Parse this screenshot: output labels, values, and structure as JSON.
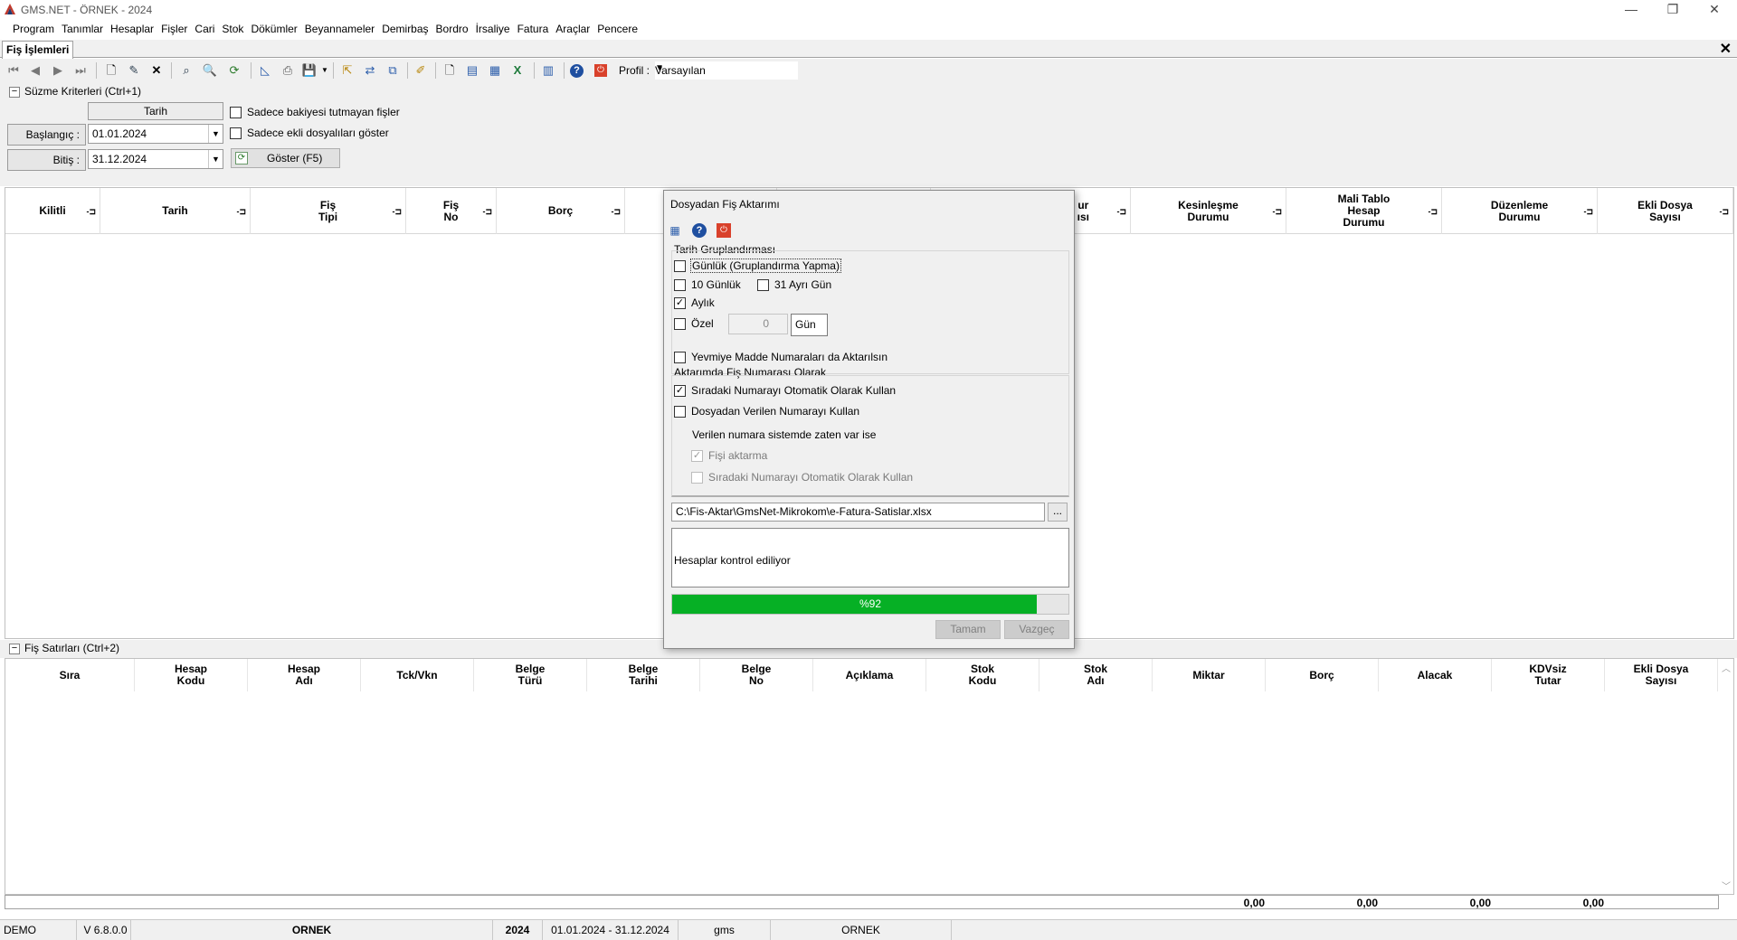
{
  "window": {
    "title": "GMS.NET - ÖRNEK - 2024",
    "minimize": "—",
    "restore": "❐",
    "close": "✕"
  },
  "menu": [
    "Program",
    "Tanımlar",
    "Hesaplar",
    "Fişler",
    "Cari",
    "Stok",
    "Dökümler",
    "Beyannameler",
    "Demirbaş",
    "Bordro",
    "İrsaliye",
    "Fatura",
    "Araçlar",
    "Pencere"
  ],
  "tab": {
    "label": "Fiş İşlemleri",
    "close": "✕"
  },
  "toolbar": {
    "profile_label": "Profil :",
    "profile_value": "Varsayılan"
  },
  "filter": {
    "section_title": "Süzme Kriterleri (Ctrl+1)",
    "date_header": "Tarih",
    "start_label": "Başlangıç :",
    "start_value": "01.01.2024",
    "end_label": "Bitiş :",
    "end_value": "31.12.2024",
    "only_unbalanced": "Sadece bakiyesi tutmayan fişler",
    "only_attached": "Sadece ekli dosyalıları göster",
    "show_button": "Göster (F5)"
  },
  "grid1": {
    "columns": [
      "Kilitli",
      "Tarih",
      "Fiş\nTipi",
      "Fiş\nNo",
      "Borç",
      "",
      "",
      "ur\nısı",
      "Kesinleşme\nDurumu",
      "Mali Tablo\nHesap\nDurumu",
      "Düzenleme\nDurumu",
      "Ekli Dosya\nSayısı"
    ]
  },
  "lower": {
    "section_title": "Fiş Satırları (Ctrl+2)",
    "columns": [
      "Sıra",
      "Hesap\nKodu",
      "Hesap\nAdı",
      "Tck/Vkn",
      "Belge\nTürü",
      "Belge\nTarihi",
      "Belge\nNo",
      "Açıklama",
      "Stok\nKodu",
      "Stok\nAdı",
      "Miktar",
      "Borç",
      "Alacak",
      "KDVsiz\nTutar",
      "Ekli Dosya\nSayısı"
    ],
    "totals": [
      "0,00",
      "0,00",
      "0,00",
      "0,00"
    ]
  },
  "statusbar": [
    "DEMO",
    "V 6.8.0.0",
    "ORNEK",
    "2024",
    "01.01.2024 - 31.12.2024",
    "gms",
    "ORNEK"
  ],
  "dialog": {
    "title": "Dosyadan Fiş Aktarımı",
    "group1_title": "Tarih Gruplandırması",
    "daily": "Günlük (Gruplandırma Yapma)",
    "ten_day": "10 Günlük",
    "thirty_one": "31 Ayrı Gün",
    "monthly": "Aylık",
    "custom": "Özel",
    "custom_value": "0",
    "custom_unit": "Gün",
    "journal": "Yevmiye Madde Numaraları da Aktarılsın",
    "group2_title": "Aktarımda Fiş Numarası Olarak",
    "auto_number": "Sıradaki Numarayı Otomatik Olarak Kullan",
    "file_number": "Dosyadan Verilen Numarayı Kullan",
    "exists_label": "Verilen numara sistemde zaten var ise",
    "skip": "Fişi aktarma",
    "auto_number2": "Sıradaki Numarayı Otomatik Olarak Kullan",
    "path": "C:\\Fis-Aktar\\GmsNet-Mikrokom\\e-Fatura-Satislar.xlsx",
    "browse": "...",
    "log": "Hesaplar kontrol ediliyor",
    "progress": 0.92,
    "progress_label": "%92",
    "ok": "Tamam",
    "cancel": "Vazgeç"
  },
  "colors": {
    "progress": "#06b025",
    "title_gray": "#555555"
  }
}
